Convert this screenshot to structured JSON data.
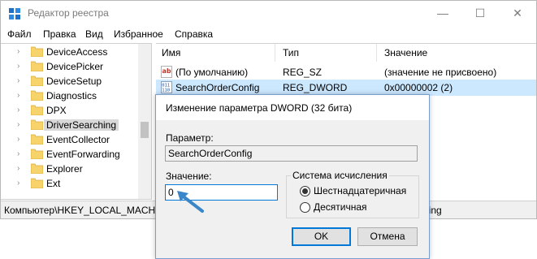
{
  "window": {
    "title": "Редактор реестра",
    "controls": {
      "minimize": "—",
      "maximize": "☐",
      "close": "✕"
    }
  },
  "menu": [
    "Файл",
    "Правка",
    "Вид",
    "Избранное",
    "Справка"
  ],
  "tree": {
    "items": [
      {
        "label": "DeviceAccess",
        "selected": false
      },
      {
        "label": "DevicePicker",
        "selected": false
      },
      {
        "label": "DeviceSetup",
        "selected": false
      },
      {
        "label": "Diagnostics",
        "selected": false
      },
      {
        "label": "DPX",
        "selected": false
      },
      {
        "label": "DriverSearching",
        "selected": true
      },
      {
        "label": "EventCollector",
        "selected": false
      },
      {
        "label": "EventForwarding",
        "selected": false
      },
      {
        "label": "Explorer",
        "selected": false
      },
      {
        "label": "Ext",
        "selected": false
      }
    ],
    "chevron": "›"
  },
  "list": {
    "columns": {
      "name": "Имя",
      "type": "Тип",
      "value": "Значение"
    },
    "rows": [
      {
        "icon": "reg-sz-icon",
        "name": "(По умолчанию)",
        "type": "REG_SZ",
        "value": "(значение не присвоено)",
        "selected": false
      },
      {
        "icon": "reg-dword-icon",
        "name": "SearchOrderConfig",
        "type": "REG_DWORD",
        "value": "0x00000002 (2)",
        "selected": true
      }
    ]
  },
  "statusbar": {
    "path": "Компьютер\\HKEY_LOCAL_MACHIN",
    "tail": "hing"
  },
  "dialog": {
    "title": "Изменение параметра DWORD (32 бита)",
    "param_label": "Параметр:",
    "param_value": "SearchOrderConfig",
    "value_label": "Значение:",
    "value_input": "0",
    "base_group": "Система исчисления",
    "base_options": [
      {
        "label": "Шестнадцатеричная",
        "checked": true
      },
      {
        "label": "Десятичная",
        "checked": false
      }
    ],
    "ok_label": "OK",
    "cancel_label": "Отмена"
  },
  "colors": {
    "selection": "#cce8ff",
    "accent": "#0078d7",
    "arrow": "#3a86c8",
    "folder": "#f6d36b"
  }
}
